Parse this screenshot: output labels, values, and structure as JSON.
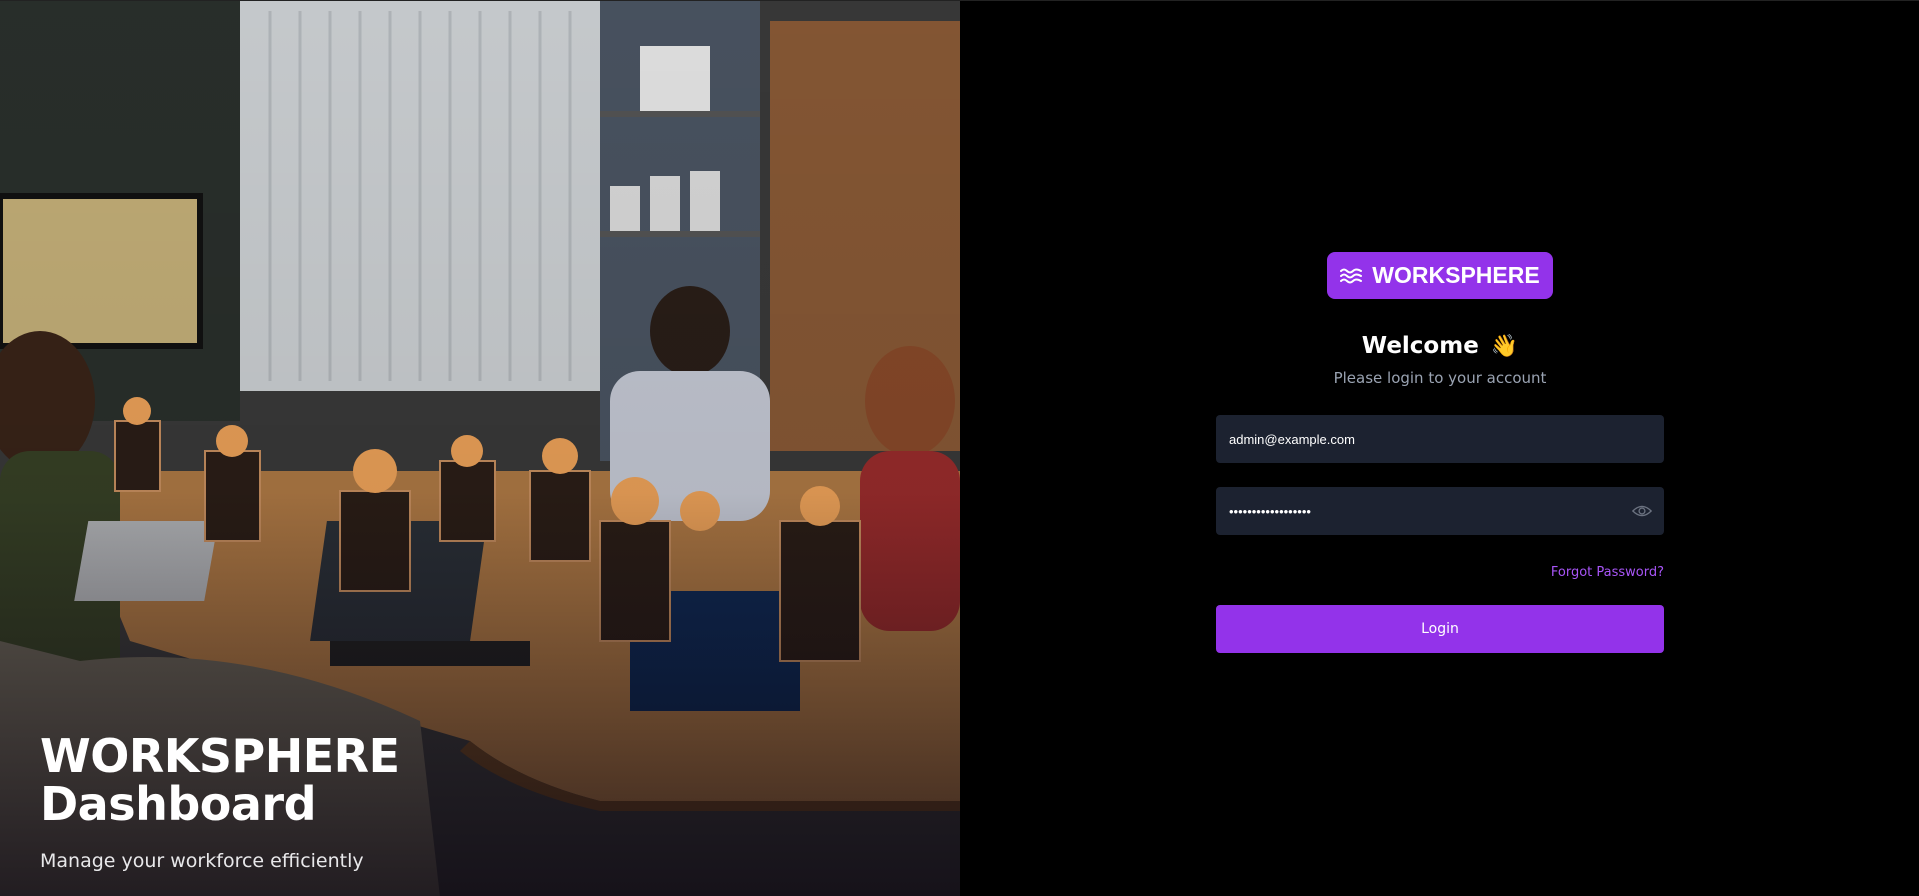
{
  "hero": {
    "title_line1": "WORKSPHERE",
    "title_line2": "Dashboard",
    "subtitle": "Manage your workforce efficiently",
    "image": "office meeting photo"
  },
  "brand": {
    "name": "WORKSPHERE",
    "icon": "waves-icon"
  },
  "login": {
    "welcome": "Welcome",
    "wave_emoji": "👋",
    "subtitle": "Please login to your account",
    "email_value": "admin@example.com",
    "password_value": "••••••••••••••••••",
    "forgot_label": "Forgot Password?",
    "login_label": "Login"
  },
  "colors": {
    "accent": "#9333ea",
    "input_bg": "#1c2230",
    "link": "#a855f7",
    "muted_text": "#9aa3b2",
    "background": "#000000"
  }
}
